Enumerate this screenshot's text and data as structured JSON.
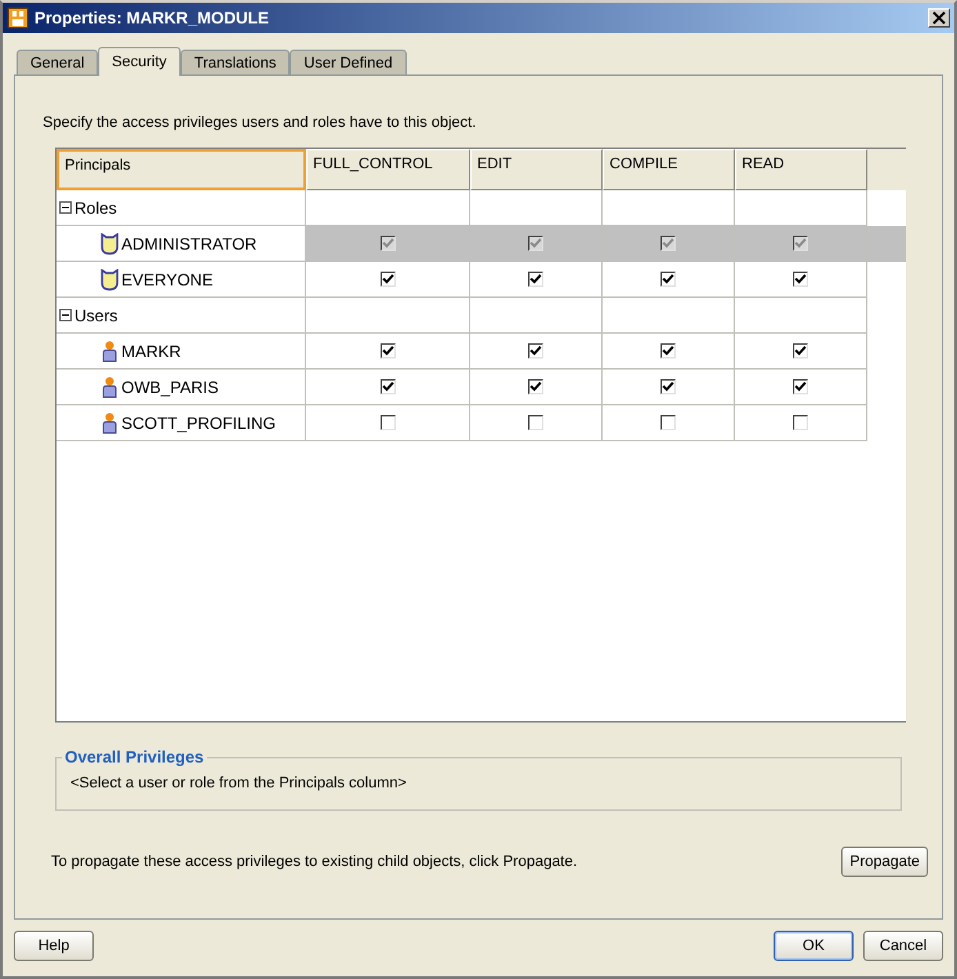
{
  "window": {
    "title": "Properties: MARKR_MODULE"
  },
  "tabs": [
    {
      "label": "General",
      "selected": false
    },
    {
      "label": "Security",
      "selected": true
    },
    {
      "label": "Translations",
      "selected": false
    },
    {
      "label": "User Defined",
      "selected": false
    }
  ],
  "instructions": "Specify the access privileges users and roles have to this object.",
  "table": {
    "columns": [
      "Principals",
      "FULL_CONTROL",
      "EDIT",
      "COMPILE",
      "READ"
    ],
    "groups": [
      {
        "label": "Roles",
        "expanded": true,
        "children": [
          {
            "name": "ADMINISTRATOR",
            "kind": "role",
            "selected": true,
            "perms": [
              {
                "checked": true,
                "disabled": true
              },
              {
                "checked": true,
                "disabled": true
              },
              {
                "checked": true,
                "disabled": true
              },
              {
                "checked": true,
                "disabled": true
              }
            ]
          },
          {
            "name": "EVERYONE",
            "kind": "role",
            "selected": false,
            "perms": [
              {
                "checked": true,
                "disabled": false
              },
              {
                "checked": true,
                "disabled": false
              },
              {
                "checked": true,
                "disabled": false
              },
              {
                "checked": true,
                "disabled": false
              }
            ]
          }
        ]
      },
      {
        "label": "Users",
        "expanded": true,
        "children": [
          {
            "name": "MARKR",
            "kind": "user",
            "selected": false,
            "perms": [
              {
                "checked": true,
                "disabled": false
              },
              {
                "checked": true,
                "disabled": false
              },
              {
                "checked": true,
                "disabled": false
              },
              {
                "checked": true,
                "disabled": false
              }
            ]
          },
          {
            "name": "OWB_PARIS",
            "kind": "user",
            "selected": false,
            "perms": [
              {
                "checked": true,
                "disabled": false
              },
              {
                "checked": true,
                "disabled": false
              },
              {
                "checked": true,
                "disabled": false
              },
              {
                "checked": true,
                "disabled": false
              }
            ]
          },
          {
            "name": "SCOTT_PROFILING",
            "kind": "user",
            "selected": false,
            "perms": [
              {
                "checked": false,
                "disabled": false
              },
              {
                "checked": false,
                "disabled": false
              },
              {
                "checked": false,
                "disabled": false
              },
              {
                "checked": false,
                "disabled": false
              }
            ]
          }
        ]
      }
    ]
  },
  "overall_privileges": {
    "title": "Overall Privileges",
    "text": "<Select a user or role from the Principals column>"
  },
  "propagate_note": "To propagate these access privileges to existing child objects, click Propagate.",
  "propagate_button": "Propagate",
  "buttons": {
    "help": "Help",
    "ok": "OK",
    "cancel": "Cancel"
  }
}
